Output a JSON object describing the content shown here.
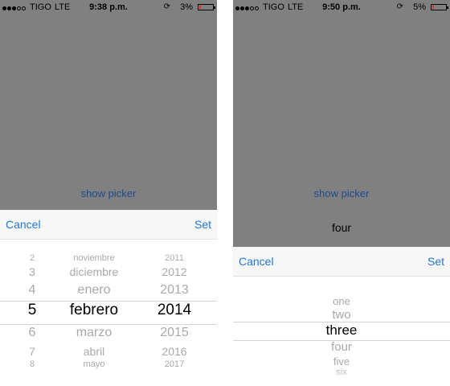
{
  "left_screen": {
    "status": {
      "carrier": "TIGO",
      "network": "LTE",
      "time": "9:38 p.m.",
      "battery": "3%",
      "battery_level": 0.03,
      "signal_bars": 3,
      "signal_total": 5
    },
    "show_picker_label": "show picker",
    "toolbar": {
      "cancel": "Cancel",
      "set": "Set"
    },
    "picker": {
      "days": [
        "2",
        "3",
        "4",
        "5",
        "6",
        "7",
        "8"
      ],
      "months": [
        "noviembre",
        "diciembre",
        "enero",
        "febrero",
        "marzo",
        "abril",
        "mayo"
      ],
      "years": [
        "2011",
        "2012",
        "2013",
        "2014",
        "2015",
        "2016",
        "2017"
      ],
      "selected_index": 3
    }
  },
  "right_screen": {
    "status": {
      "carrier": "TIGO",
      "network": "LTE",
      "time": "9:50 p.m.",
      "battery": "5%",
      "battery_level": 0.05,
      "signal_bars": 3,
      "signal_total": 5
    },
    "show_picker_label": "show picker",
    "selected_value": "four",
    "toolbar": {
      "cancel": "Cancel",
      "set": "Set"
    },
    "picker": {
      "items": [
        "one",
        "two",
        "three",
        "four",
        "five",
        "six"
      ],
      "selected_index": 2
    }
  },
  "colors": {
    "overlay": "#808080",
    "link": "#1c4a8e",
    "toolbar_button": "#1f78d1",
    "battery_low": "#e0312c"
  },
  "icons": {
    "rotation_lock": "rotation-lock-icon",
    "battery": "battery-icon",
    "signal": "signal-dots-icon"
  }
}
